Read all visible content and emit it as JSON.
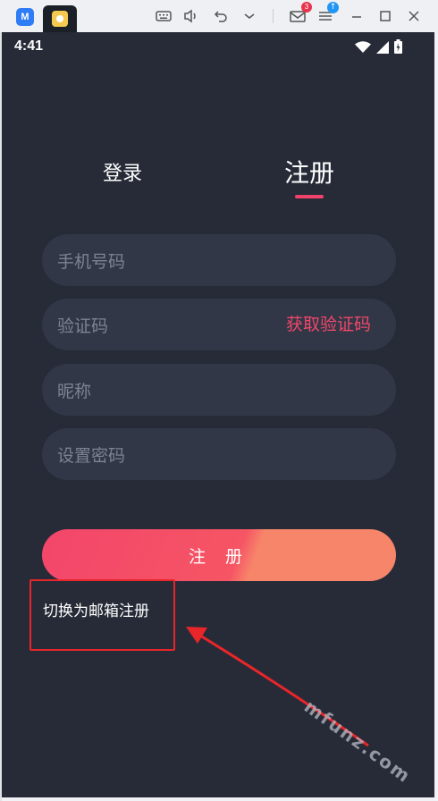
{
  "chrome": {
    "logo_letter": "M",
    "mail_badge": "3",
    "update_badge": "↑"
  },
  "status": {
    "time": "4:41"
  },
  "tabs": {
    "login": "登录",
    "register": "注册"
  },
  "form": {
    "phone_placeholder": "手机号码",
    "code_placeholder": "验证码",
    "get_code": "获取验证码",
    "nickname_placeholder": "昵称",
    "password_placeholder": "设置密码",
    "submit": "注 册",
    "switch_email": "切换为邮箱注册"
  },
  "watermark": "mfunz.com",
  "colors": {
    "background": "#262b37",
    "field": "#323747",
    "accent": "#f0426a",
    "annotation": "#e8262a"
  }
}
